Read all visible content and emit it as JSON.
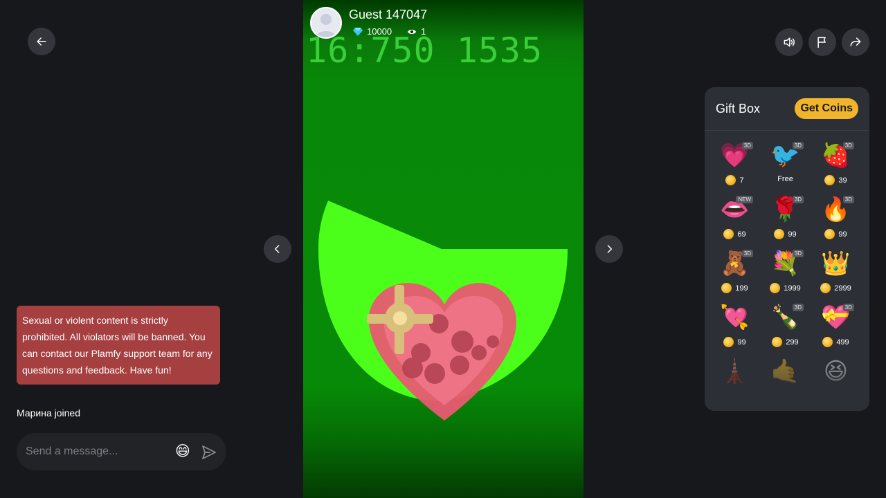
{
  "streamer": {
    "name": "Guest 147047",
    "diamonds": "10000",
    "viewers": "1"
  },
  "video": {
    "overlay_text": "16:750 1535"
  },
  "chat": {
    "notice": "Sexual or violent content is strictly prohibited. All violators will be banned. You can contact our Plamfy support team for any questions and feedback. Have fun!",
    "join_message": "Марина joined",
    "input_placeholder": "Send a message...",
    "emoji": "😄"
  },
  "gift_box": {
    "title": "Gift Box",
    "get_coins_label": "Get Coins",
    "gifts": [
      {
        "icon": "follow-me-heart",
        "glyph": "💗",
        "price": "7",
        "badge": "3D",
        "coin": true
      },
      {
        "icon": "hi-bird",
        "glyph": "🐦",
        "price": "Free",
        "badge": "3D",
        "coin": false
      },
      {
        "icon": "strawberry",
        "glyph": "🍓",
        "price": "39",
        "badge": "3D",
        "coin": true
      },
      {
        "icon": "lips",
        "glyph": "👄",
        "price": "69",
        "badge": "NEW",
        "coin": true
      },
      {
        "icon": "rose",
        "glyph": "🌹",
        "price": "99",
        "badge": "3D",
        "coin": true
      },
      {
        "icon": "fire",
        "glyph": "🔥",
        "price": "99",
        "badge": "3D",
        "coin": true
      },
      {
        "icon": "teddy-bear",
        "glyph": "🧸",
        "price": "199",
        "badge": "3D",
        "coin": true
      },
      {
        "icon": "rose-bouquet",
        "glyph": "💐",
        "price": "1999",
        "badge": "3D",
        "coin": true
      },
      {
        "icon": "tiara",
        "glyph": "👑",
        "price": "2999",
        "badge": "",
        "coin": true
      },
      {
        "icon": "heart-arrow",
        "glyph": "💘",
        "price": "99",
        "badge": "",
        "coin": true
      },
      {
        "icon": "champagne",
        "glyph": "🍾",
        "price": "299",
        "badge": "3D",
        "coin": true
      },
      {
        "icon": "heart-gift-box",
        "glyph": "💝",
        "price": "499",
        "badge": "3D",
        "coin": true
      },
      {
        "icon": "eiffel-tower",
        "glyph": "🗼",
        "price": "",
        "badge": "",
        "coin": false
      },
      {
        "icon": "hand-gesture",
        "glyph": "🤙",
        "price": "",
        "badge": "",
        "coin": false
      },
      {
        "icon": "laughing-face",
        "glyph": "😆",
        "price": "",
        "badge": "",
        "coin": false
      }
    ]
  },
  "colors": {
    "background": "#17181b",
    "notice": "#a53f40",
    "get_coins": "#f0b52a",
    "panel": "#2c2f35",
    "video_green": "#088808",
    "shape_green": "#4cff1a"
  }
}
